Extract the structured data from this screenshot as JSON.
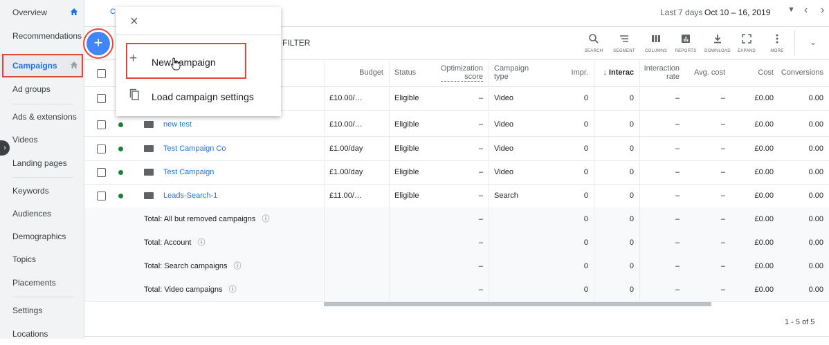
{
  "sidebar": {
    "items": [
      {
        "label": "Overview"
      },
      {
        "label": "Recommendations"
      },
      {
        "label": "Campaigns"
      },
      {
        "label": "Ad groups"
      },
      {
        "label": "Ads & extensions"
      },
      {
        "label": "Videos"
      },
      {
        "label": "Landing pages"
      },
      {
        "label": "Keywords"
      },
      {
        "label": "Audiences"
      },
      {
        "label": "Demographics"
      },
      {
        "label": "Topics"
      },
      {
        "label": "Placements"
      },
      {
        "label": "Settings"
      },
      {
        "label": "Locations"
      }
    ]
  },
  "topbar": {
    "tab_partial": "C",
    "date_range_label": "Last 7 days",
    "date_range_value": "Oct 10 – 16, 2019"
  },
  "filter_label": "FILTER",
  "toolbar": [
    {
      "label": "SEARCH",
      "icon": "search-icon"
    },
    {
      "label": "SEGMENT",
      "icon": "segment-icon"
    },
    {
      "label": "COLUMNS",
      "icon": "columns-icon"
    },
    {
      "label": "REPORTS",
      "icon": "reports-icon"
    },
    {
      "label": "DOWNLOAD",
      "icon": "download-icon"
    },
    {
      "label": "EXPAND",
      "icon": "expand-icon"
    },
    {
      "label": "MORE",
      "icon": "more-icon"
    }
  ],
  "menu": {
    "new_campaign": "New campaign",
    "load_settings": "Load campaign settings"
  },
  "table": {
    "headers": {
      "budget": "Budget",
      "status": "Status",
      "opt1": "Optimization",
      "opt2": "score",
      "type1": "Campaign",
      "type2": "type",
      "impr": "Impr.",
      "interac": "Interac",
      "irate1": "Interaction",
      "irate2": "rate",
      "avgcost": "Avg. cost",
      "cost": "Cost",
      "conv": "Conversions"
    },
    "rows": [
      {
        "name": "",
        "budget": "£10.00/…",
        "status": "Eligible",
        "opt": "–",
        "type": "Video",
        "impr": "0",
        "inter": "0",
        "irate": "–",
        "avg": "–",
        "cost": "£0.00",
        "conv": "0.00"
      },
      {
        "name": "new test",
        "budget": "£10.00/…",
        "status": "Eligible",
        "opt": "–",
        "type": "Video",
        "impr": "0",
        "inter": "0",
        "irate": "–",
        "avg": "–",
        "cost": "£0.00",
        "conv": "0.00"
      },
      {
        "name": "Test Campaign Co",
        "budget": "£1.00/day",
        "status": "Eligible",
        "opt": "–",
        "type": "Video",
        "impr": "0",
        "inter": "0",
        "irate": "–",
        "avg": "–",
        "cost": "£0.00",
        "conv": "0.00"
      },
      {
        "name": "Test Campaign",
        "budget": "£1.00/day",
        "status": "Eligible",
        "opt": "–",
        "type": "Video",
        "impr": "0",
        "inter": "0",
        "irate": "–",
        "avg": "–",
        "cost": "£0.00",
        "conv": "0.00"
      },
      {
        "name": "Leads-Search-1",
        "budget": "£11.00/…",
        "status": "Eligible",
        "opt": "–",
        "type": "Search",
        "impr": "0",
        "inter": "0",
        "irate": "–",
        "avg": "–",
        "cost": "£0.00",
        "conv": "0.00"
      }
    ],
    "totals": [
      {
        "label": "Total: All but removed campaigns",
        "opt": "–",
        "impr": "0",
        "inter": "0",
        "irate": "–",
        "avg": "–",
        "cost": "£0.00",
        "conv": "0.00"
      },
      {
        "label": "Total: Account",
        "opt": "–",
        "impr": "0",
        "inter": "0",
        "irate": "–",
        "avg": "–",
        "cost": "£0.00",
        "conv": "0.00"
      },
      {
        "label": "Total: Search campaigns",
        "opt": "–",
        "impr": "0",
        "inter": "0",
        "irate": "–",
        "avg": "–",
        "cost": "£0.00",
        "conv": "0.00"
      },
      {
        "label": "Total: Video campaigns",
        "opt": "–",
        "impr": "0",
        "inter": "0",
        "irate": "–",
        "avg": "–",
        "cost": "£0.00",
        "conv": "0.00"
      }
    ],
    "pagination": "1 - 5 of 5"
  },
  "colors": {
    "accent": "#1a73e8",
    "highlight": "#ea4335",
    "enabled": "#188038"
  }
}
